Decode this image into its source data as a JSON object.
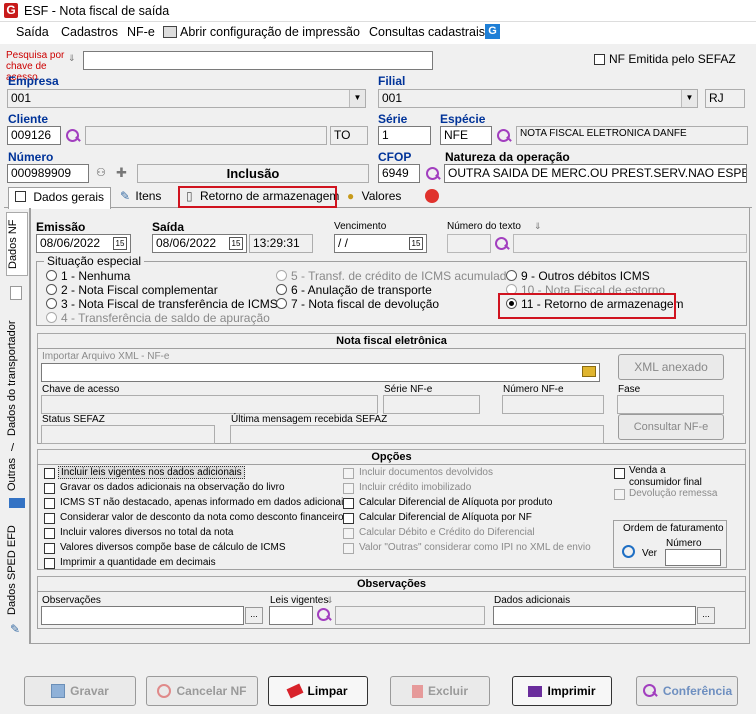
{
  "window": {
    "title": "ESF - Nota fiscal de saída"
  },
  "menu": {
    "items": [
      "Saída",
      "Cadastros",
      "NF-e",
      "Abrir configuração de impressão",
      "Consultas cadastrais"
    ]
  },
  "search": {
    "label": "Pesquisa por chave de acesso",
    "value": "",
    "nf_emitida_label": "NF Emitida pelo SEFAZ"
  },
  "empresa": {
    "label": "Empresa",
    "value": "001"
  },
  "filial": {
    "label": "Filial",
    "value": "001",
    "uf": "RJ"
  },
  "cliente": {
    "label": "Cliente",
    "code": "009126",
    "uf": "TO"
  },
  "serie": {
    "label": "Série",
    "value": "1"
  },
  "especie": {
    "label": "Espécie",
    "code": "NFE",
    "description": "NOTA FISCAL ELETRONICA DANFE"
  },
  "numero": {
    "label": "Número",
    "value": "000989909",
    "status": "Inclusão"
  },
  "cfop": {
    "label": "CFOP",
    "value": "6949"
  },
  "natureza": {
    "label": "Natureza da operação",
    "value": "OUTRA SAIDA DE MERC.OU PREST.SERV.NAO ESPECIF."
  },
  "tabs": [
    {
      "label": "Dados gerais"
    },
    {
      "label": "Itens"
    },
    {
      "label": "Retorno de armazenagem"
    },
    {
      "label": "Valores"
    }
  ],
  "side_tabs": [
    "Dados NF",
    "Dados do transportador",
    "Outras",
    "Dados SPED EFD"
  ],
  "emissao": {
    "label": "Emissão",
    "value": "08/06/2022"
  },
  "saida": {
    "label": "Saída",
    "value": "08/06/2022",
    "time": "13:29:31"
  },
  "vencimento": {
    "label": "Vencimento",
    "value": " / /"
  },
  "numero_texto": {
    "label": "Número do texto"
  },
  "situacao": {
    "label": "Situação especial",
    "options": [
      "1 - Nenhuma",
      "2 - Nota Fiscal complementar",
      "3 - Nota Fiscal de transferência de ICMS",
      "4 - Transferência de saldo de apuração",
      "5 - Transf. de crédito de ICMS acumulado",
      "6 - Anulação de transporte",
      "7 - Nota fiscal de devolução",
      "9 - Outros débitos ICMS",
      "10 - Nota Fiscal de estorno",
      "11 - Retorno de armazenagem"
    ]
  },
  "nfe": {
    "title": "Nota fiscal eletrônica",
    "importar_label": "Importar Arquivo XML - NF-e",
    "xml_button": "XML anexado",
    "chave_label": "Chave de acesso",
    "serie_label": "Série NF-e",
    "numero_label": "Número NF-e",
    "fase_label": "Fase",
    "status_label": "Status SEFAZ",
    "ultima_label": "Última mensagem recebida SEFAZ",
    "consultar_button": "Consultar NF-e"
  },
  "opcoes": {
    "title": "Opções",
    "left": [
      "Incluir leis vigentes nos dados adicionais",
      "Gravar os dados adicionais na observação do livro",
      "ICMS ST não destacado, apenas informado em dados adicionais",
      "Considerar valor de desconto da nota como desconto financeiro",
      "Incluir valores diversos no total da nota",
      "Valores diversos compõe base de cálculo de ICMS",
      "Imprimir a quantidade em decimais"
    ],
    "middle": [
      "Incluir documentos devolvidos",
      "Incluir crédito imobilizado",
      "Calcular Diferencial de Alíquota por produto",
      "Calcular Diferencial de Alíquota por NF",
      "Calcular Débito e Crédito do Diferencial",
      "Valor \"Outras\" considerar como IPI no XML de envio"
    ],
    "right": [
      "Venda a consumidor final",
      "Devolução remessa"
    ],
    "faturamento": {
      "title": "Ordem de faturamento",
      "ver": "Ver",
      "numero": "Número"
    }
  },
  "observacoes": {
    "title": "Observações",
    "obs_label": "Observações",
    "leis_label": "Leis vigentes",
    "dados_label": "Dados adicionais"
  },
  "buttons": [
    "Gravar",
    "Cancelar NF",
    "Limpar",
    "Excluir",
    "Imprimir",
    "Conferência"
  ]
}
